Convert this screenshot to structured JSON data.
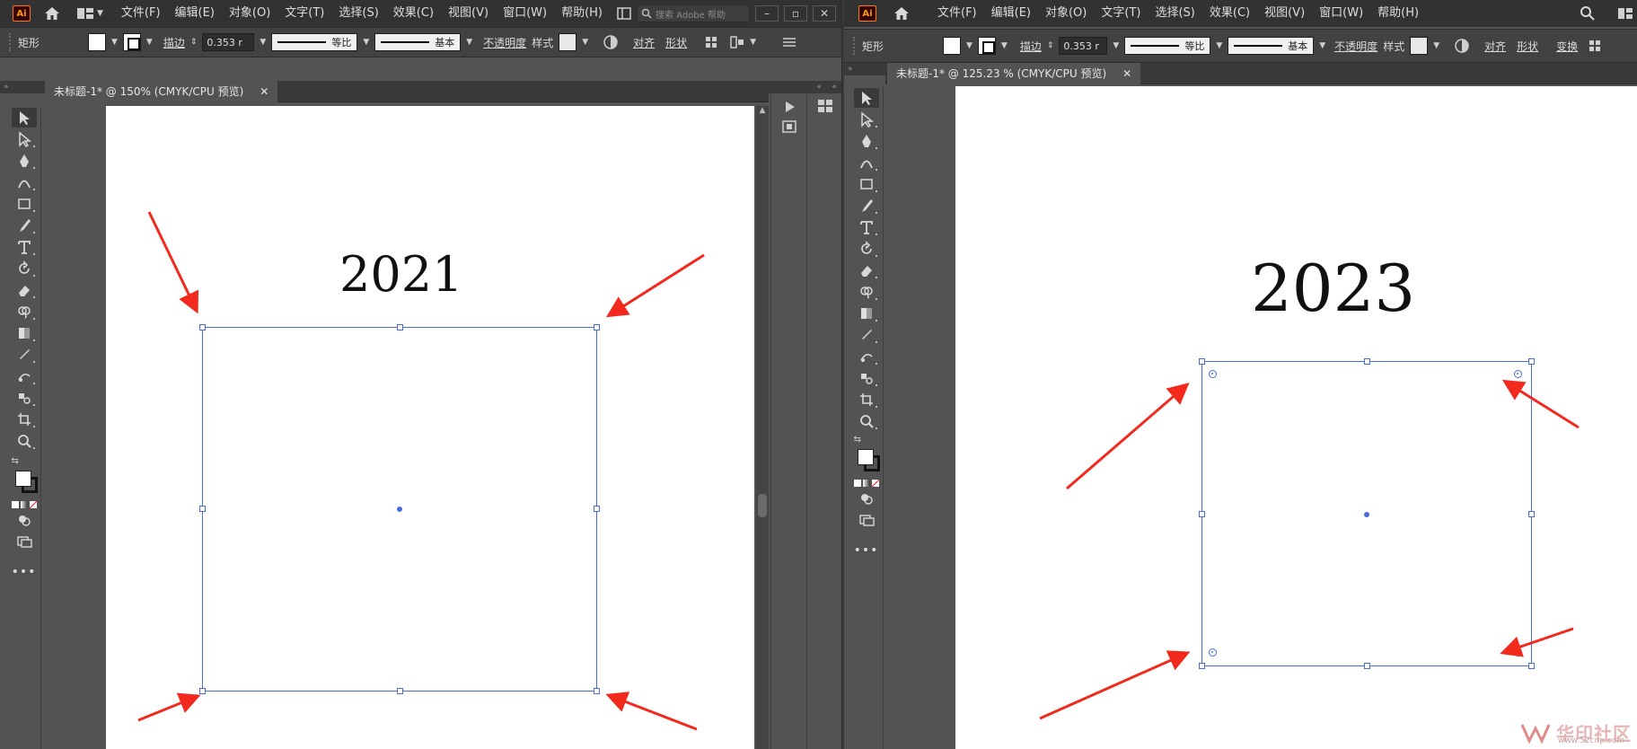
{
  "left": {
    "menu": [
      "文件(F)",
      "编辑(E)",
      "对象(O)",
      "文字(T)",
      "选择(S)",
      "效果(C)",
      "视图(V)",
      "窗口(W)",
      "帮助(H)"
    ],
    "search_placeholder": "搜索 Adobe 帮助",
    "control": {
      "shape_label": "矩形",
      "stroke_label": "描边",
      "stroke_value": "0.353 r",
      "stroke_profile": "等比",
      "brush": "基本",
      "opacity_label": "不透明度",
      "style_label": "样式",
      "align": "对齐",
      "shape": "形状"
    },
    "tab_title": "未标题-1* @ 150% (CMYK/CPU 预览)",
    "year": "2021"
  },
  "right": {
    "menu": [
      "文件(F)",
      "编辑(E)",
      "对象(O)",
      "文字(T)",
      "选择(S)",
      "效果(C)",
      "视图(V)",
      "窗口(W)",
      "帮助(H)"
    ],
    "control": {
      "shape_label": "矩形",
      "stroke_label": "描边",
      "stroke_value": "0.353 r",
      "stroke_profile": "等比",
      "brush": "基本",
      "opacity_label": "不透明度",
      "style_label": "样式",
      "align": "对齐",
      "shape": "形状",
      "transform": "变换"
    },
    "tab_title": "未标题-1* @ 125.23 % (CMYK/CPU 预览)",
    "year": "2023"
  },
  "watermark": {
    "text": "华印社区",
    "url": "www.52cnp.com"
  },
  "colors": {
    "selection": "#4a6bdc",
    "arrow": "#f22a1e",
    "ui_bg": "#535353",
    "menubar": "#323232"
  }
}
